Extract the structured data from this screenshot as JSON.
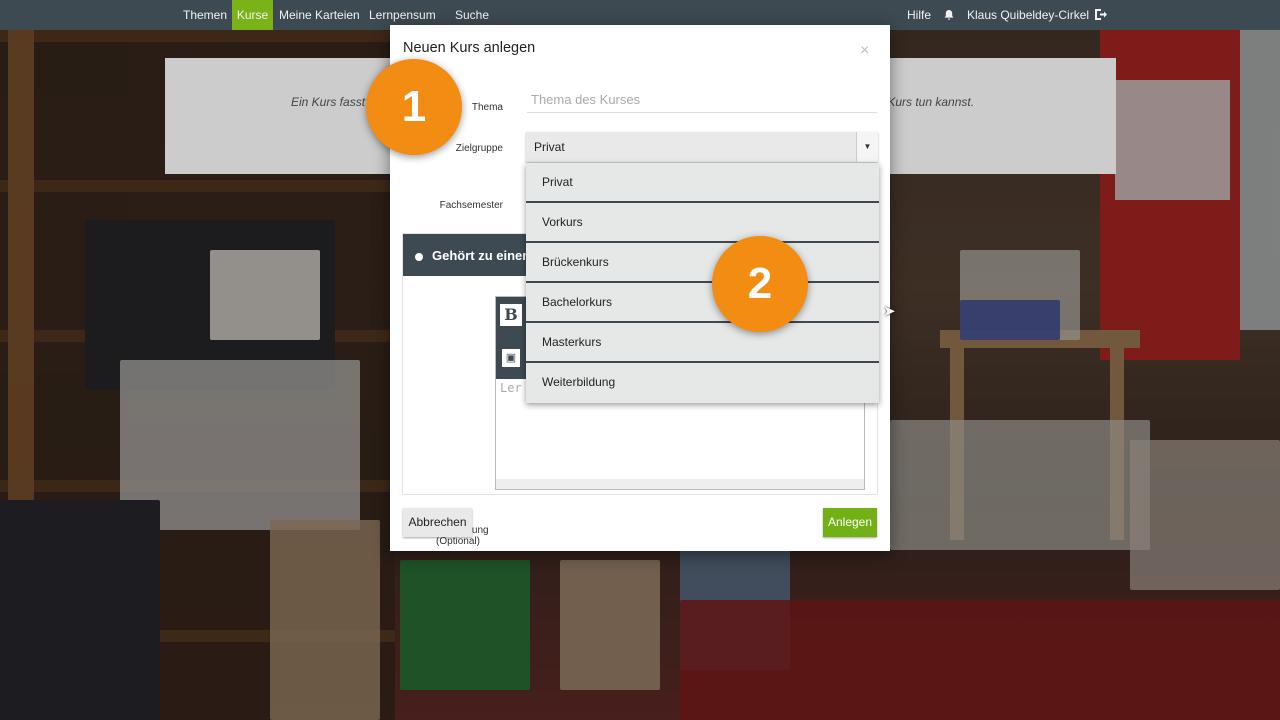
{
  "navbar": {
    "items": [
      {
        "label": "Themen",
        "active": false
      },
      {
        "label": "Kurse",
        "active": true
      },
      {
        "label": "Meine Karteien",
        "active": false
      },
      {
        "label": "Lernpensum",
        "active": false
      }
    ],
    "search_label": "Suche",
    "help_label": "Hilfe",
    "bell_icon": "bell-icon",
    "user_name": "Klaus Quibeldey-Cirkel",
    "logout_icon": "logout-icon",
    "active_color": "#7ab317"
  },
  "page": {
    "jumbotron_left": "Ein Kurs fasst",
    "jumbotron_right": "m Kurs tun kannst."
  },
  "modal": {
    "title": "Neuen Kurs anlegen",
    "close": "×",
    "thema_label": "Thema",
    "thema_placeholder": "Thema des Kurses",
    "thema_value": "",
    "zielgruppe_label": "Zielgruppe",
    "zielgruppe_selected": "Privat",
    "fachsemester_label": "Fachsemester",
    "panel_text": "Gehört zu einem",
    "beschreibung_label": "Beschreibung",
    "beschreibung_optional": "(Optional)",
    "editor_bold": "B",
    "editor_placeholder_fragment": "Ler",
    "cancel_label": "Abbrechen",
    "create_label": "Anlegen",
    "create_color": "#72b015"
  },
  "dropdown": {
    "options": [
      "Privat",
      "Vorkurs",
      "Brückenkurs",
      "Bachelorkurs",
      "Masterkurs",
      "Weiterbildung"
    ]
  },
  "markers": [
    "1",
    "2"
  ]
}
